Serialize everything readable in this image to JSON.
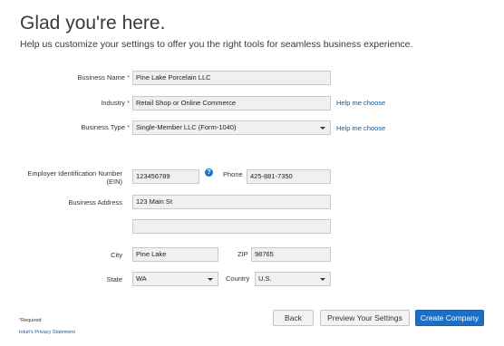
{
  "header": {
    "title": "Glad you're here.",
    "subtitle": "Help us customize your settings to offer you the right tools for seamless business experience."
  },
  "form": {
    "business_name": {
      "label": "Business Name",
      "required_mark": "*",
      "value": "Pine Lake Porcelain LLC"
    },
    "industry": {
      "label": "Industry",
      "required_mark": "*",
      "value": "Retail Shop or Online Commerce",
      "help_link": "Help me choose"
    },
    "business_type": {
      "label": "Business Type",
      "required_mark": "*",
      "value": "Single-Member LLC (Form-1040)",
      "help_link": "Help me choose"
    },
    "ein": {
      "label_line1": "Employer Identification Number",
      "label_line2": "(EIN)",
      "value": "123456789",
      "help_icon": "?"
    },
    "phone": {
      "label": "Phone",
      "value": "425-881-7350"
    },
    "address": {
      "label": "Business Address",
      "line1": "123 Main St",
      "line2": ""
    },
    "city": {
      "label": "City",
      "value": "Pine Lake"
    },
    "zip": {
      "label": "ZIP",
      "value": "98765"
    },
    "state": {
      "label": "State",
      "value": "WA"
    },
    "country": {
      "label": "Country",
      "value": "U.S."
    }
  },
  "footer": {
    "required_note": "Required",
    "required_mark": "*",
    "privacy_link": "Intuit's Privacy Statement",
    "back_button": "Back",
    "preview_button": "Preview Your Settings",
    "create_button": "Create Company"
  },
  "colors": {
    "primary_button": "#1e6fc4",
    "link": "#0a5da9",
    "required": "#d52b1e",
    "field_bg": "#f0f0f0"
  }
}
